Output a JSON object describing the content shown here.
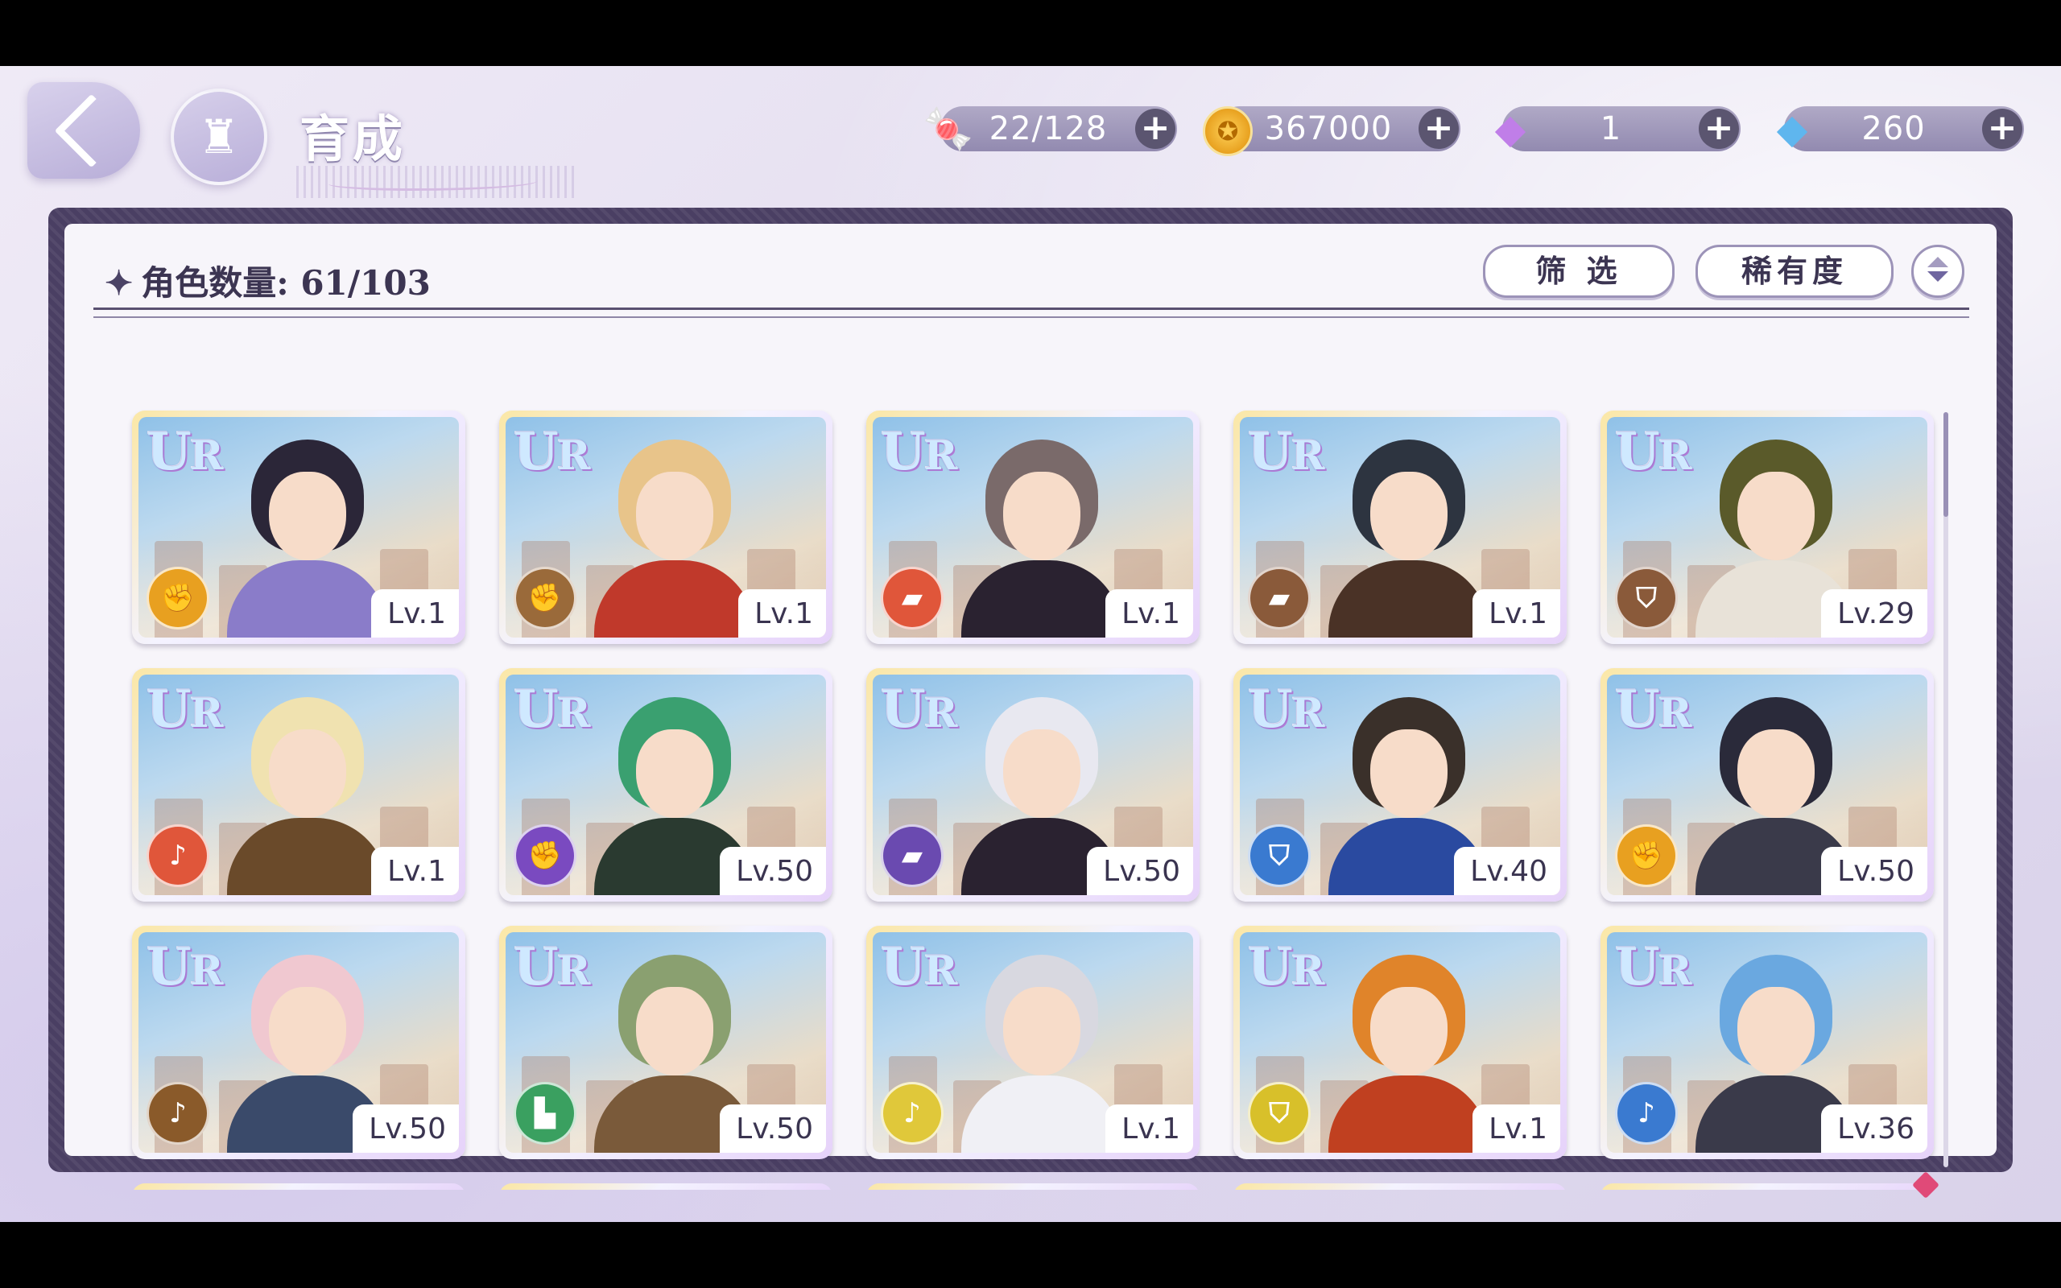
{
  "header": {
    "title": "育成",
    "back_icon": "back-arrow-icon",
    "home_icon": "castle-icon"
  },
  "currencies": [
    {
      "name": "candy",
      "icon": "candy-icon",
      "value": "22/128",
      "plus": "+"
    },
    {
      "name": "coin",
      "icon": "gold-coin-icon",
      "value": "367000",
      "plus": "+"
    },
    {
      "name": "pink-diamond",
      "icon": "pink-diamond-icon",
      "value": "1",
      "plus": "+"
    },
    {
      "name": "blue-diamond",
      "icon": "blue-diamond-icon",
      "value": "260",
      "plus": "+"
    }
  ],
  "toolbar": {
    "count_label": "角色数量: 61/103",
    "filter_label": "筛 选",
    "rarity_label": "稀有度"
  },
  "characters": [
    {
      "rarity": "UR",
      "attr": "fist",
      "attr_color": "#e8a020",
      "level": "Lv.1",
      "hair": "#2b2638",
      "outfit": "#8a7cc9"
    },
    {
      "rarity": "UR",
      "attr": "fist",
      "attr_color": "#9a6a3a",
      "level": "Lv.1",
      "hair": "#e8c48a",
      "outfit": "#c0392b"
    },
    {
      "rarity": "UR",
      "attr": "card",
      "attr_color": "#e0563a",
      "level": "Lv.1",
      "hair": "#7a6a6a",
      "outfit": "#2a2230"
    },
    {
      "rarity": "UR",
      "attr": "card",
      "attr_color": "#8a5a3a",
      "level": "Lv.1",
      "hair": "#2d3440",
      "outfit": "#4a3226"
    },
    {
      "rarity": "UR",
      "attr": "shield",
      "attr_color": "#8a5a3a",
      "level": "Lv.29",
      "hair": "#5a5a2a",
      "outfit": "#e8e2d8"
    },
    {
      "rarity": "UR",
      "attr": "horn",
      "attr_color": "#e0563a",
      "level": "Lv.1",
      "hair": "#f0e2b0",
      "outfit": "#6a4a2a"
    },
    {
      "rarity": "UR",
      "attr": "fist",
      "attr_color": "#7a4ac0",
      "level": "Lv.50",
      "hair": "#3aa070",
      "outfit": "#2a3a30"
    },
    {
      "rarity": "UR",
      "attr": "card",
      "attr_color": "#6a4ab0",
      "level": "Lv.50",
      "hair": "#e8e8f0",
      "outfit": "#2a2230"
    },
    {
      "rarity": "UR",
      "attr": "shield",
      "attr_color": "#3a7ad0",
      "level": "Lv.40",
      "hair": "#3a302a",
      "outfit": "#2a4aa0"
    },
    {
      "rarity": "UR",
      "attr": "fist",
      "attr_color": "#e8a020",
      "level": "Lv.50",
      "hair": "#2a2a3a",
      "outfit": "#3a3a4a"
    },
    {
      "rarity": "UR",
      "attr": "horn",
      "attr_color": "#8a5a2a",
      "level": "Lv.50",
      "hair": "#f0c8d0",
      "outfit": "#3a4a6a"
    },
    {
      "rarity": "UR",
      "attr": "boot",
      "attr_color": "#3aa060",
      "level": "Lv.50",
      "hair": "#8aa070",
      "outfit": "#7a5a3a"
    },
    {
      "rarity": "UR",
      "attr": "horn",
      "attr_color": "#e0c83a",
      "level": "Lv.1",
      "hair": "#d8d8e0",
      "outfit": "#f0f0f5"
    },
    {
      "rarity": "UR",
      "attr": "shield",
      "attr_color": "#d8c02a",
      "level": "Lv.1",
      "hair": "#e0842a",
      "outfit": "#c04020"
    },
    {
      "rarity": "UR",
      "attr": "horn",
      "attr_color": "#3a7ad0",
      "level": "Lv.36",
      "hair": "#6aa8e0",
      "outfit": "#3a3a4a"
    }
  ]
}
